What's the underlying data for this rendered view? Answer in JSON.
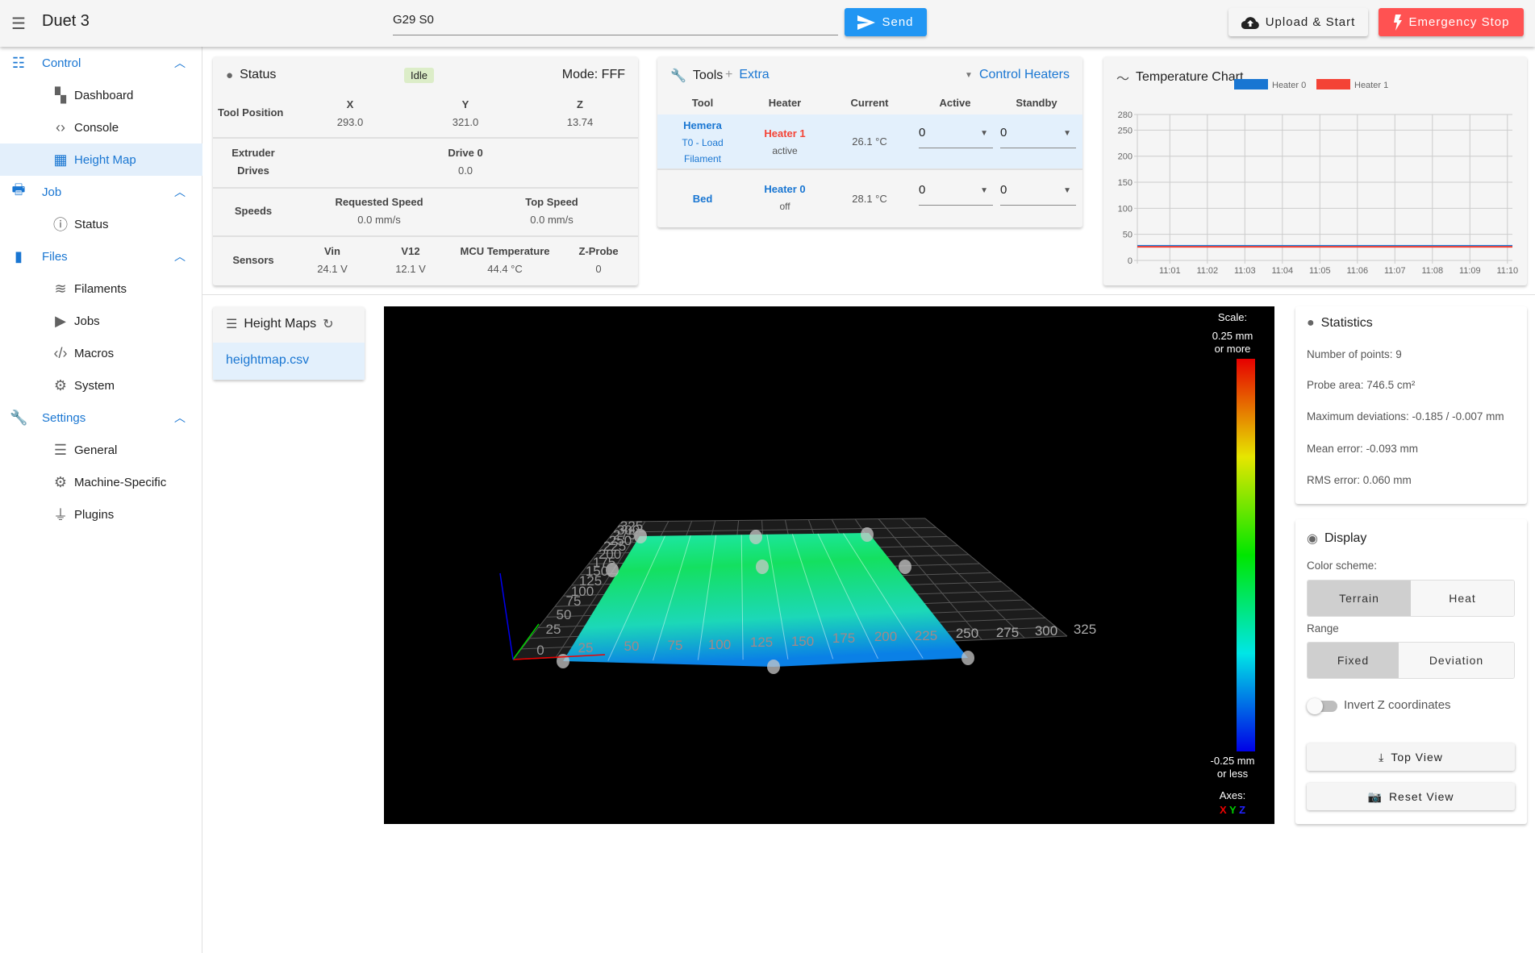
{
  "app": {
    "title": "Duet 3",
    "menu_icon": "hamburger-icon"
  },
  "console": {
    "value": "G29 S0",
    "send_label": "Send"
  },
  "actions": {
    "upload_label": "Upload & Start",
    "emergency_label": "Emergency Stop",
    "emergency_color": "#ff5252",
    "accent": "#2196f3"
  },
  "sidebar": {
    "groups": [
      {
        "label": "Control",
        "items": [
          "Dashboard",
          "Console",
          "Height Map"
        ]
      },
      {
        "label": "Job",
        "items": [
          "Status"
        ]
      },
      {
        "label": "Files",
        "items": [
          "Filaments",
          "Jobs",
          "Macros",
          "System"
        ]
      },
      {
        "label": "Settings",
        "items": [
          "General",
          "Machine-Specific",
          "Plugins"
        ]
      }
    ],
    "active": "Height Map"
  },
  "status": {
    "title": "Status",
    "state": "Idle",
    "mode": "Mode: FFF",
    "tool_position": {
      "label": "Tool Position",
      "axes": [
        {
          "name": "X",
          "value": "293.0"
        },
        {
          "name": "Y",
          "value": "321.0"
        },
        {
          "name": "Z",
          "value": "13.74"
        }
      ]
    },
    "extruder": {
      "label1": "Extruder",
      "label2": "Drives",
      "drive_label": "Drive 0",
      "drive_value": "0.0"
    },
    "speeds": {
      "label": "Speeds",
      "requested_label": "Requested Speed",
      "requested_value": "0.0 mm/s",
      "top_label": "Top Speed",
      "top_value": "0.0 mm/s"
    },
    "sensors": {
      "label": "Sensors",
      "items": [
        {
          "name": "Vin",
          "value": "24.1 V"
        },
        {
          "name": "V12",
          "value": "12.1 V"
        },
        {
          "name": "MCU Temperature",
          "value": "44.4 °C"
        },
        {
          "name": "Z-Probe",
          "value": "0"
        }
      ]
    }
  },
  "tools": {
    "title": "Tools",
    "extra_label": "Extra",
    "control_heaters_label": "Control Heaters",
    "columns": [
      "Tool",
      "Heater",
      "Current",
      "Active",
      "Standby"
    ],
    "rows": [
      {
        "tool": "Hemera",
        "tool_sub1": "T0 - Load",
        "tool_sub2": "Filament",
        "heater": "Heater 1",
        "heater_state": "active",
        "current": "26.1 °C",
        "active": "0",
        "standby": "0"
      },
      {
        "tool": "Bed",
        "heater": "Heater 0",
        "heater_state": "off",
        "current": "28.1 °C",
        "active": "0",
        "standby": "0"
      }
    ]
  },
  "chart_data": {
    "type": "line",
    "title": "Temperature Chart",
    "xlabel": "",
    "ylabel": "",
    "ylim": [
      0,
      280
    ],
    "yticks": [
      0,
      50,
      100,
      150,
      200,
      250,
      280
    ],
    "xticks": [
      "11:01",
      "11:02",
      "11:03",
      "11:04",
      "11:05",
      "11:06",
      "11:07",
      "11:08",
      "11:09",
      "11:10"
    ],
    "xlim": [
      "11:00:08",
      "11:10:08"
    ],
    "grid": true,
    "legend": "top",
    "x": [
      "11:00:08",
      "11:01",
      "11:02",
      "11:03",
      "11:04",
      "11:05",
      "11:06",
      "11:07",
      "11:08",
      "11:09",
      "11:10",
      "11:10:08"
    ],
    "series": [
      {
        "name": "Heater 0",
        "color": "#1976d2",
        "values": [
          28.1,
          28.1,
          28.1,
          28.1,
          28.1,
          28.1,
          28.1,
          28.1,
          28.1,
          28.1,
          28.1,
          28.1
        ]
      },
      {
        "name": "Heater 1",
        "color": "#f44336",
        "values": [
          26.1,
          26.1,
          26.1,
          26.1,
          26.1,
          26.1,
          26.1,
          26.1,
          26.1,
          26.1,
          26.1,
          26.1
        ]
      }
    ]
  },
  "heightmaps": {
    "title": "Height Maps",
    "files": [
      "heightmap.csv"
    ]
  },
  "viewer": {
    "scale_label": "Scale:",
    "max_label1": "0.25 mm",
    "max_label2": "or more",
    "min_label1": "-0.25 mm",
    "min_label2": "or less",
    "axes_label": "Axes:",
    "axis_x": "X",
    "axis_y": "Y",
    "axis_z": "Z",
    "x_ticks": [
      "25",
      "50",
      "75",
      "100",
      "125",
      "150",
      "175",
      "200",
      "225",
      "250",
      "275",
      "300",
      "325"
    ],
    "y_ticks": [
      "0",
      "25",
      "50",
      "75",
      "100",
      "125",
      "150",
      "175",
      "200",
      "225",
      "250",
      "275",
      "300",
      "325"
    ]
  },
  "statistics": {
    "title": "Statistics",
    "lines": [
      "Number of points: 9",
      "Probe area: 746.5 cm²",
      "Maximum deviations: -0.185 / -0.007 mm",
      "Mean error: -0.093 mm",
      "RMS error: 0.060 mm"
    ]
  },
  "display": {
    "title": "Display",
    "color_scheme_label": "Color scheme:",
    "schemes": [
      "Terrain",
      "Heat"
    ],
    "scheme_selected": "Terrain",
    "range_label": "Range",
    "ranges": [
      "Fixed",
      "Deviation"
    ],
    "range_selected": "Fixed",
    "invert_label": "Invert Z coordinates",
    "invert_on": false,
    "top_view_label": "Top View",
    "reset_view_label": "Reset View"
  }
}
